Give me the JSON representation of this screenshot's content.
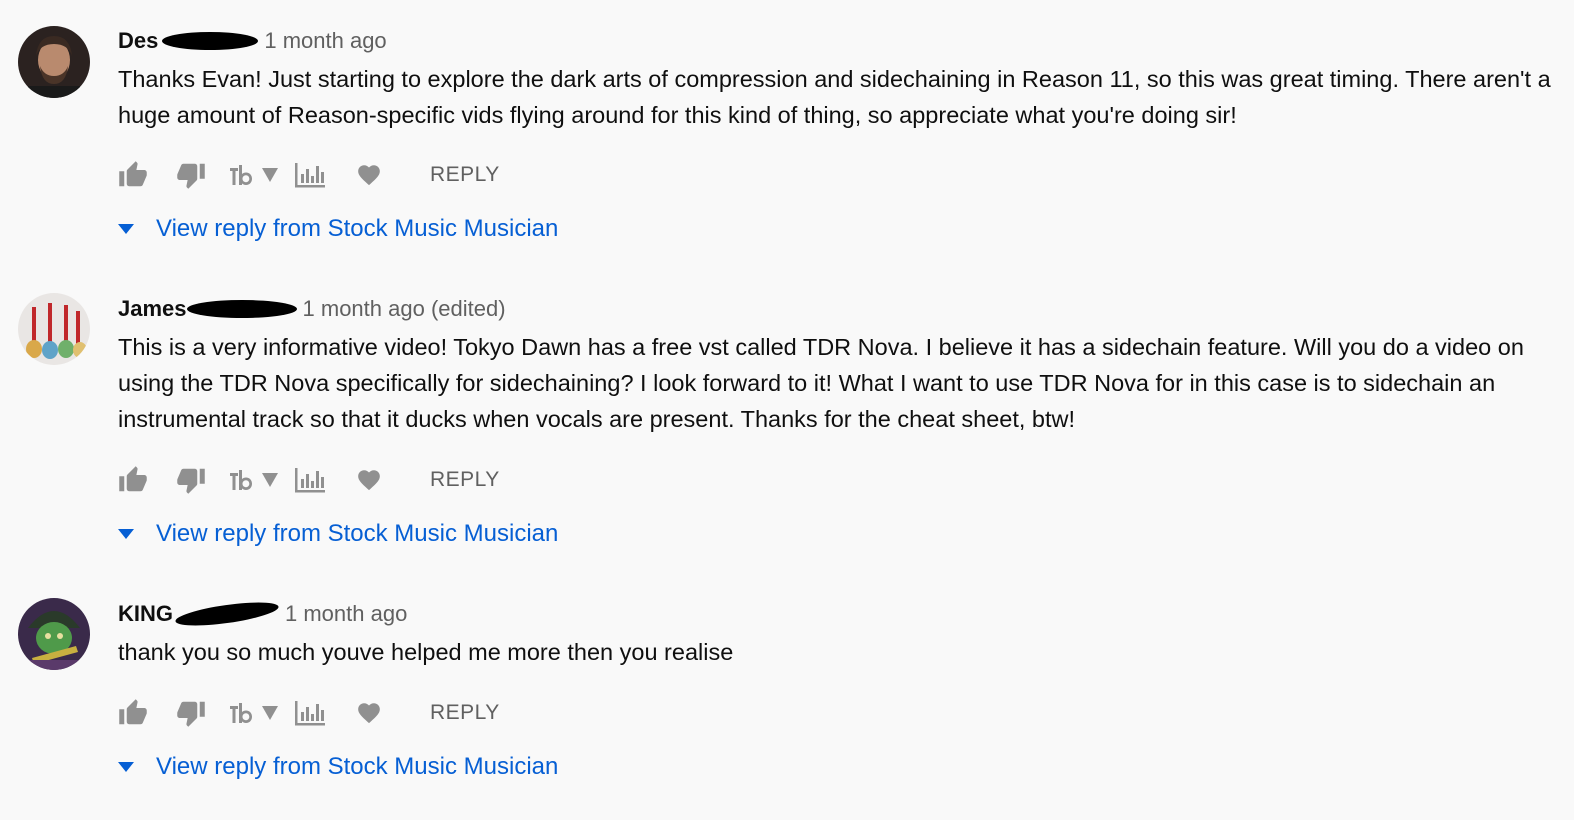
{
  "comments": [
    {
      "author": "Des",
      "time": "1 month ago",
      "text": "Thanks Evan!  Just starting to explore the dark arts of compression and sidechaining in Reason 11, so this was great timing. There aren't a huge amount of Reason-specific vids flying around for this kind of thing, so appreciate what you're doing sir!",
      "reply_label": "REPLY",
      "view_reply_label": "View reply from Stock Music Musician"
    },
    {
      "author": "James",
      "time": "1 month ago (edited)",
      "text": "This is a very informative video! Tokyo Dawn has a free vst called TDR Nova. I believe it has a sidechain feature. Will you do a video on using the TDR Nova specifically for sidechaining? I look forward to it! What I want to use TDR Nova for in this case is to sidechain an instrumental track so that it ducks when vocals are present. Thanks for the cheat sheet, btw!",
      "reply_label": "REPLY",
      "view_reply_label": "View reply from Stock Music Musician"
    },
    {
      "author": "KING",
      "time": "1 month ago",
      "text": "thank you so much youve helped me more then you realise",
      "reply_label": "REPLY",
      "view_reply_label": "View reply from Stock Music Musician"
    }
  ],
  "icons": {
    "like": "thumb-up-icon",
    "dislike": "thumb-down-icon",
    "tubebuddy": "tubebuddy-icon",
    "stats": "bar-chart-icon",
    "heart": "heart-icon",
    "expand": "caret-down-icon"
  },
  "colors": {
    "background": "#f9f9f9",
    "link": "#065fd4",
    "secondary_text": "#606060",
    "icon": "#909090"
  }
}
